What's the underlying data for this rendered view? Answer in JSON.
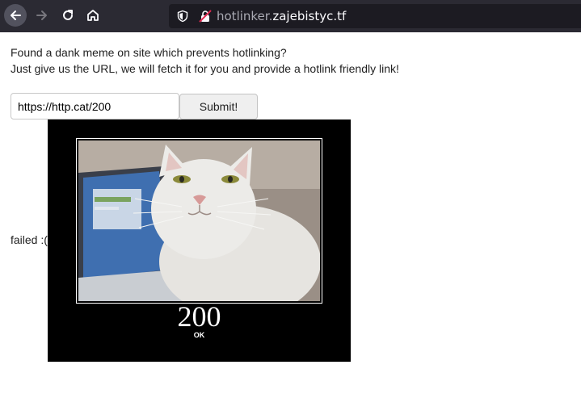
{
  "browser": {
    "url_subdomain": "hotlinker.",
    "url_domain": "zajebistyc.tf",
    "icons": {
      "back": "arrow-left-icon",
      "forward": "arrow-right-icon",
      "reload": "reload-icon",
      "home": "home-icon",
      "tracking": "shield-icon",
      "security": "insecure-lock-icon"
    }
  },
  "page": {
    "intro_line1": "Found a dank meme on site which prevents hotlinking?",
    "intro_line2": "Just give us the URL, we will fetch it for you and provide a hotlink friendly link!",
    "url_value": "https://http.cat/200",
    "submit_label": "Submit!",
    "failed_text": "failed :(",
    "image": {
      "status_code": "200",
      "status_text": "OK"
    }
  },
  "colors": {
    "toolbar_bg": "#2b2a33",
    "urlbar_bg": "#1c1b22",
    "insecure_red": "#e22850"
  }
}
